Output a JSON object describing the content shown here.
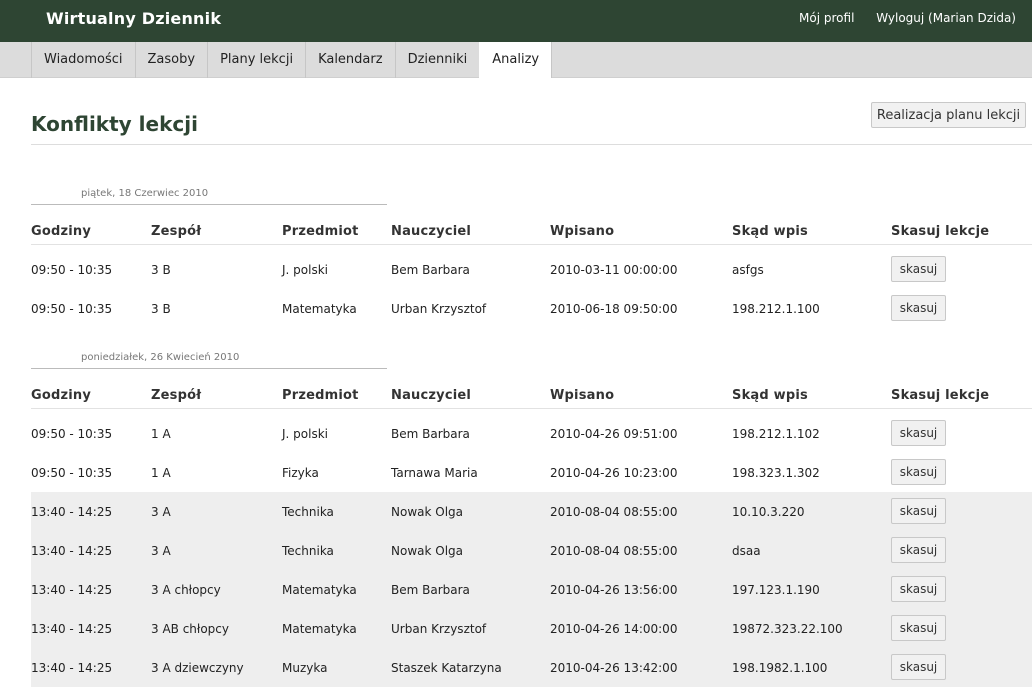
{
  "app": {
    "title": "Wirtualny Dziennik",
    "profile_link": "Mój profil",
    "logout_link": "Wyloguj (Marian Dzida)"
  },
  "tabs": [
    {
      "label": "Wiadomości",
      "active": false
    },
    {
      "label": "Zasoby",
      "active": false
    },
    {
      "label": "Plany lekcji",
      "active": false
    },
    {
      "label": "Kalendarz",
      "active": false
    },
    {
      "label": "Dzienniki",
      "active": false
    },
    {
      "label": "Analizy",
      "active": true
    }
  ],
  "page": {
    "title": "Konflikty lekcji",
    "plan_button": "Realizacja planu lekcji"
  },
  "columns": [
    "Godziny",
    "Zespół",
    "Przedmiot",
    "Nauczyciel",
    "Wpisano",
    "Skąd wpis",
    "Skasuj lekcje"
  ],
  "delete_label": "skasuj",
  "groups": [
    {
      "date": "piątek, 18 Czerwiec 2010",
      "rows": [
        {
          "hours": "09:50 - 10:35",
          "team": "3 B",
          "subject": "J. polski",
          "teacher": "Bem Barbara",
          "entered": "2010-03-11 00:00:00",
          "source": "asfgs",
          "shaded": false
        },
        {
          "hours": "09:50 - 10:35",
          "team": "3 B",
          "subject": "Matematyka",
          "teacher": "Urban Krzysztof",
          "entered": "2010-06-18 09:50:00",
          "source": "198.212.1.100",
          "shaded": false
        }
      ]
    },
    {
      "date": "poniedziałek, 26 Kwiecień 2010",
      "rows": [
        {
          "hours": "09:50 - 10:35",
          "team": "1 A",
          "subject": "J. polski",
          "teacher": "Bem Barbara",
          "entered": "2010-04-26 09:51:00",
          "source": "198.212.1.102",
          "shaded": false
        },
        {
          "hours": "09:50 - 10:35",
          "team": "1 A",
          "subject": "Fizyka",
          "teacher": "Tarnawa Maria",
          "entered": "2010-04-26 10:23:00",
          "source": "198.323.1.302",
          "shaded": false
        },
        {
          "hours": "13:40 - 14:25",
          "team": "3 A",
          "subject": "Technika",
          "teacher": "Nowak Olga",
          "entered": "2010-08-04 08:55:00",
          "source": "10.10.3.220",
          "shaded": true
        },
        {
          "hours": "13:40 - 14:25",
          "team": "3 A",
          "subject": "Technika",
          "teacher": "Nowak Olga",
          "entered": "2010-08-04 08:55:00",
          "source": "dsaa",
          "shaded": true
        },
        {
          "hours": "13:40 - 14:25",
          "team": "3 A chłopcy",
          "subject": "Matematyka",
          "teacher": "Bem Barbara",
          "entered": "2010-04-26 13:56:00",
          "source": "197.123.1.190",
          "shaded": true
        },
        {
          "hours": "13:40 - 14:25",
          "team": "3 AB chłopcy",
          "subject": "Matematyka",
          "teacher": "Urban Krzysztof",
          "entered": "2010-04-26 14:00:00",
          "source": "19872.323.22.100",
          "shaded": true
        },
        {
          "hours": "13:40 - 14:25",
          "team": "3 A dziewczyny",
          "subject": "Muzyka",
          "teacher": "Staszek Katarzyna",
          "entered": "2010-04-26 13:42:00",
          "source": "198.1982.1.100",
          "shaded": true
        }
      ]
    }
  ]
}
